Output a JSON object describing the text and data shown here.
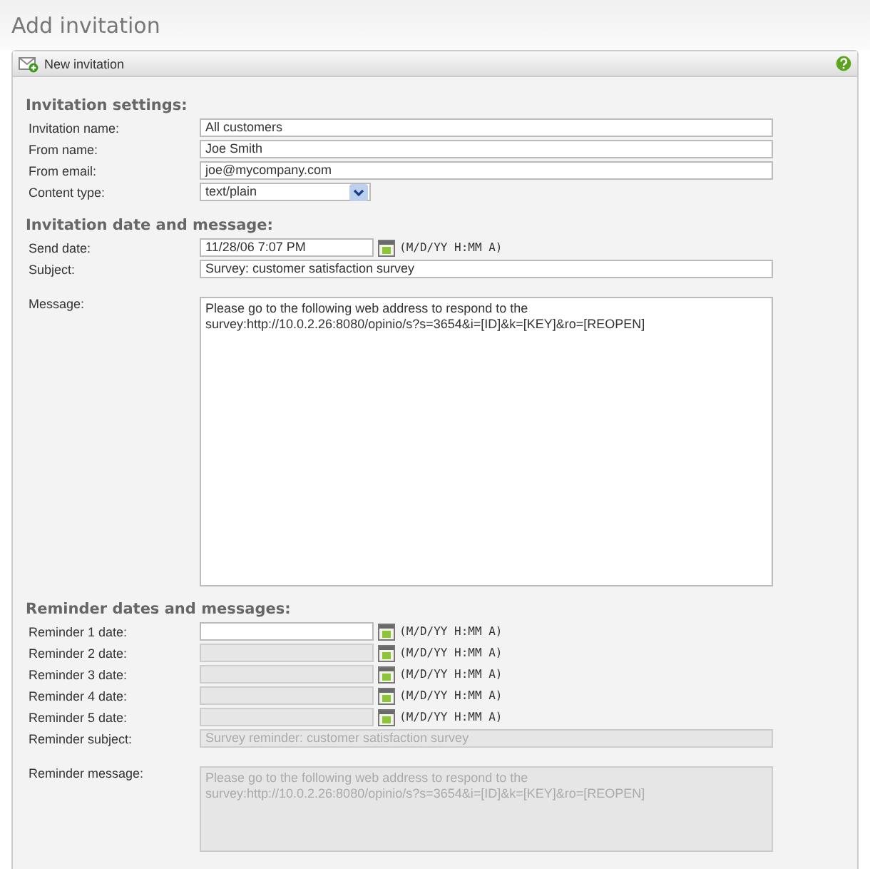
{
  "page_title": "Add invitation",
  "panel": {
    "title": "New invitation"
  },
  "sections": [
    {
      "heading": "Invitation settings:",
      "rows": [
        {
          "kind": "text",
          "label": "Invitation name:",
          "value": "All customers",
          "disabled": false
        },
        {
          "kind": "text",
          "label": "From name:",
          "value": "Joe Smith",
          "disabled": false
        },
        {
          "kind": "text",
          "label": "From email:",
          "value": "joe@mycompany.com",
          "disabled": false
        },
        {
          "kind": "select",
          "label": "Content type:",
          "value": "text/plain",
          "disabled": false
        }
      ]
    },
    {
      "heading": "Invitation date and message:",
      "rows": [
        {
          "kind": "date",
          "label": "Send date:",
          "value": "11/28/06 7:07 PM",
          "hint": "(M/D/YY H:MM A)",
          "disabled": false
        },
        {
          "kind": "text",
          "label": "Subject:",
          "value": "Survey: customer satisfaction survey",
          "disabled": false
        },
        {
          "kind": "textarea",
          "label": "Message:",
          "value": "Please go to the following web address to respond to the\nsurvey:http://10.0.2.26:8080/opinio/s?s=3654&i=[ID]&k=[KEY]&ro=[REOPEN]",
          "disabled": false
        }
      ]
    },
    {
      "heading": "Reminder dates and messages:",
      "rows": [
        {
          "kind": "date",
          "label": "Reminder 1 date:",
          "hint": "(M/D/YY H:MM A)",
          "disabled": false
        },
        {
          "kind": "date",
          "label": "Reminder 2 date:",
          "hint": "(M/D/YY H:MM A)",
          "disabled": true
        },
        {
          "kind": "date",
          "label": "Reminder 3 date:",
          "hint": "(M/D/YY H:MM A)",
          "disabled": true
        },
        {
          "kind": "date",
          "label": "Reminder 4 date:",
          "hint": "(M/D/YY H:MM A)",
          "disabled": true
        },
        {
          "kind": "date",
          "label": "Reminder 5 date:",
          "hint": "(M/D/YY H:MM A)",
          "disabled": true
        },
        {
          "kind": "text",
          "label": "Reminder subject:",
          "value": "Survey reminder: customer satisfaction survey",
          "disabled": true
        },
        {
          "kind": "textarea_short",
          "label": "Reminder message:",
          "value": "Please go to the following web address to respond to the\nsurvey:http://10.0.2.26:8080/opinio/s?s=3654&i=[ID]&k=[KEY]&ro=[REOPEN]",
          "disabled": true
        }
      ]
    }
  ]
}
